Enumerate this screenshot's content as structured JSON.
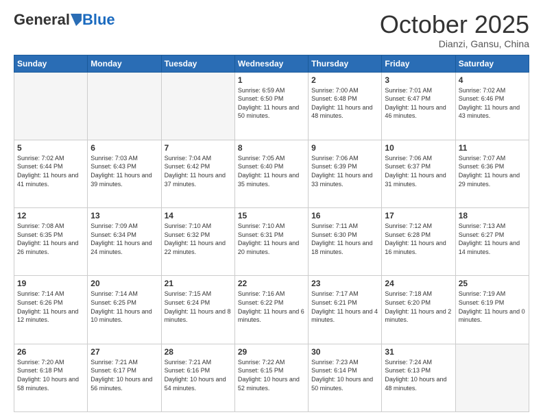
{
  "header": {
    "logo": {
      "general": "General",
      "blue": "Blue"
    },
    "title": "October 2025",
    "location": "Dianzi, Gansu, China"
  },
  "days_of_week": [
    "Sunday",
    "Monday",
    "Tuesday",
    "Wednesday",
    "Thursday",
    "Friday",
    "Saturday"
  ],
  "weeks": [
    [
      {
        "day": "",
        "info": ""
      },
      {
        "day": "",
        "info": ""
      },
      {
        "day": "",
        "info": ""
      },
      {
        "day": "1",
        "info": "Sunrise: 6:59 AM\nSunset: 6:50 PM\nDaylight: 11 hours and 50 minutes."
      },
      {
        "day": "2",
        "info": "Sunrise: 7:00 AM\nSunset: 6:48 PM\nDaylight: 11 hours and 48 minutes."
      },
      {
        "day": "3",
        "info": "Sunrise: 7:01 AM\nSunset: 6:47 PM\nDaylight: 11 hours and 46 minutes."
      },
      {
        "day": "4",
        "info": "Sunrise: 7:02 AM\nSunset: 6:46 PM\nDaylight: 11 hours and 43 minutes."
      }
    ],
    [
      {
        "day": "5",
        "info": "Sunrise: 7:02 AM\nSunset: 6:44 PM\nDaylight: 11 hours and 41 minutes."
      },
      {
        "day": "6",
        "info": "Sunrise: 7:03 AM\nSunset: 6:43 PM\nDaylight: 11 hours and 39 minutes."
      },
      {
        "day": "7",
        "info": "Sunrise: 7:04 AM\nSunset: 6:42 PM\nDaylight: 11 hours and 37 minutes."
      },
      {
        "day": "8",
        "info": "Sunrise: 7:05 AM\nSunset: 6:40 PM\nDaylight: 11 hours and 35 minutes."
      },
      {
        "day": "9",
        "info": "Sunrise: 7:06 AM\nSunset: 6:39 PM\nDaylight: 11 hours and 33 minutes."
      },
      {
        "day": "10",
        "info": "Sunrise: 7:06 AM\nSunset: 6:37 PM\nDaylight: 11 hours and 31 minutes."
      },
      {
        "day": "11",
        "info": "Sunrise: 7:07 AM\nSunset: 6:36 PM\nDaylight: 11 hours and 29 minutes."
      }
    ],
    [
      {
        "day": "12",
        "info": "Sunrise: 7:08 AM\nSunset: 6:35 PM\nDaylight: 11 hours and 26 minutes."
      },
      {
        "day": "13",
        "info": "Sunrise: 7:09 AM\nSunset: 6:34 PM\nDaylight: 11 hours and 24 minutes."
      },
      {
        "day": "14",
        "info": "Sunrise: 7:10 AM\nSunset: 6:32 PM\nDaylight: 11 hours and 22 minutes."
      },
      {
        "day": "15",
        "info": "Sunrise: 7:10 AM\nSunset: 6:31 PM\nDaylight: 11 hours and 20 minutes."
      },
      {
        "day": "16",
        "info": "Sunrise: 7:11 AM\nSunset: 6:30 PM\nDaylight: 11 hours and 18 minutes."
      },
      {
        "day": "17",
        "info": "Sunrise: 7:12 AM\nSunset: 6:28 PM\nDaylight: 11 hours and 16 minutes."
      },
      {
        "day": "18",
        "info": "Sunrise: 7:13 AM\nSunset: 6:27 PM\nDaylight: 11 hours and 14 minutes."
      }
    ],
    [
      {
        "day": "19",
        "info": "Sunrise: 7:14 AM\nSunset: 6:26 PM\nDaylight: 11 hours and 12 minutes."
      },
      {
        "day": "20",
        "info": "Sunrise: 7:14 AM\nSunset: 6:25 PM\nDaylight: 11 hours and 10 minutes."
      },
      {
        "day": "21",
        "info": "Sunrise: 7:15 AM\nSunset: 6:24 PM\nDaylight: 11 hours and 8 minutes."
      },
      {
        "day": "22",
        "info": "Sunrise: 7:16 AM\nSunset: 6:22 PM\nDaylight: 11 hours and 6 minutes."
      },
      {
        "day": "23",
        "info": "Sunrise: 7:17 AM\nSunset: 6:21 PM\nDaylight: 11 hours and 4 minutes."
      },
      {
        "day": "24",
        "info": "Sunrise: 7:18 AM\nSunset: 6:20 PM\nDaylight: 11 hours and 2 minutes."
      },
      {
        "day": "25",
        "info": "Sunrise: 7:19 AM\nSunset: 6:19 PM\nDaylight: 11 hours and 0 minutes."
      }
    ],
    [
      {
        "day": "26",
        "info": "Sunrise: 7:20 AM\nSunset: 6:18 PM\nDaylight: 10 hours and 58 minutes."
      },
      {
        "day": "27",
        "info": "Sunrise: 7:21 AM\nSunset: 6:17 PM\nDaylight: 10 hours and 56 minutes."
      },
      {
        "day": "28",
        "info": "Sunrise: 7:21 AM\nSunset: 6:16 PM\nDaylight: 10 hours and 54 minutes."
      },
      {
        "day": "29",
        "info": "Sunrise: 7:22 AM\nSunset: 6:15 PM\nDaylight: 10 hours and 52 minutes."
      },
      {
        "day": "30",
        "info": "Sunrise: 7:23 AM\nSunset: 6:14 PM\nDaylight: 10 hours and 50 minutes."
      },
      {
        "day": "31",
        "info": "Sunrise: 7:24 AM\nSunset: 6:13 PM\nDaylight: 10 hours and 48 minutes."
      },
      {
        "day": "",
        "info": ""
      }
    ]
  ]
}
